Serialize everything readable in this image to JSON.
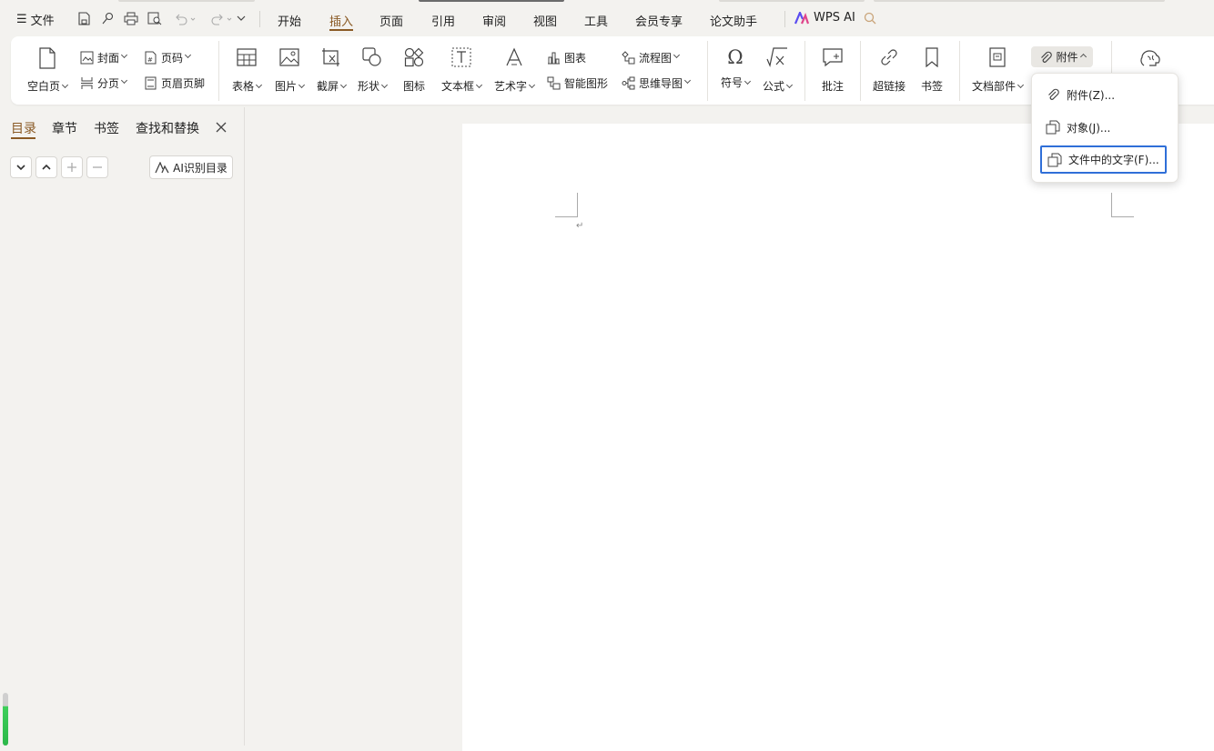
{
  "topbar": {
    "file_menu": "文件",
    "tabs": [
      "开始",
      "插入",
      "页面",
      "引用",
      "审阅",
      "视图",
      "工具",
      "会员专享",
      "论文助手"
    ],
    "wps_ai": "WPS AI"
  },
  "ribbon": {
    "blank_page": "空白页",
    "cover": "封面",
    "page_break": "分页",
    "page_number": "页码",
    "header_footer": "页眉页脚",
    "table": "表格",
    "picture": "图片",
    "screenshot": "截屏",
    "shape": "形状",
    "icon": "图标",
    "textbox": "文本框",
    "wordart": "艺术字",
    "chart": "图表",
    "smartart": "智能图形",
    "flowchart": "流程图",
    "mindmap": "思维导图",
    "symbol": "符号",
    "formula": "公式",
    "comment": "批注",
    "hyperlink": "超链接",
    "bookmark": "书签",
    "doc_parts": "文档部件",
    "attachment": "附件"
  },
  "attachment_menu": {
    "items": [
      "附件(Z)...",
      "对象(J)...",
      "文件中的文字(F)..."
    ],
    "selected_index": 2
  },
  "nav_pane": {
    "tabs": [
      "目录",
      "章节",
      "书签",
      "查找和替换"
    ],
    "ai_toc": "AI识别目录"
  },
  "colors": {
    "accent": "#8a5a25",
    "selection_border": "#2f6fd8"
  }
}
